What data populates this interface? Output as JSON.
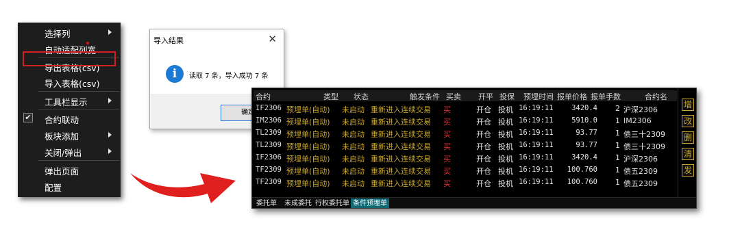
{
  "context_menu": {
    "items": [
      {
        "label": "选择列",
        "submenu": true
      },
      {
        "label": "自动适配列宽",
        "submenu": false
      },
      {
        "label": "导出表格(csv)",
        "submenu": false
      },
      {
        "label": "导入表格(csv)",
        "submenu": false,
        "highlighted": true
      },
      {
        "label": "工具栏显示",
        "submenu": true
      },
      {
        "label": "合约联动",
        "submenu": false,
        "checked": true
      },
      {
        "label": "板块添加",
        "submenu": true
      },
      {
        "label": "关闭/弹出",
        "submenu": true
      },
      {
        "label": "弹出页面",
        "submenu": false
      },
      {
        "label": "配置",
        "submenu": false
      }
    ],
    "check_mark": "✔"
  },
  "dialog": {
    "title": "导入结果",
    "close": "✕",
    "icon": "i",
    "message": "读取 7 条，导入成功 7 条",
    "ok_button": "确定"
  },
  "table": {
    "headers": {
      "contract": "合约",
      "type": "类型",
      "status": "状态",
      "trigger": "触发条件",
      "side": "买卖",
      "open": "开平",
      "hedge": "投保",
      "time": "预埋时间",
      "price": "报单价格",
      "qty": "报单手数",
      "name": "合约名"
    },
    "rows": [
      {
        "contract": "IF2306",
        "type": "预埋单(自动)",
        "status": "未启动",
        "trigger": "重新进入连续交易",
        "side": "买",
        "open": "开仓",
        "hedge": "投机",
        "time": "16:19:11",
        "price": "3420.4",
        "qty": "2",
        "name": "沪深2306"
      },
      {
        "contract": "IM2306",
        "type": "预埋单(自动)",
        "status": "未启动",
        "trigger": "重新进入连续交易",
        "side": "买",
        "open": "开仓",
        "hedge": "投机",
        "time": "16:19:11",
        "price": "5910.0",
        "qty": "1",
        "name": "IM2306"
      },
      {
        "contract": "TL2309",
        "type": "预埋单(自动)",
        "status": "未启动",
        "trigger": "重新进入连续交易",
        "side": "买",
        "open": "开仓",
        "hedge": "投机",
        "time": "16:19:11",
        "price": "93.77",
        "qty": "1",
        "name": "债三十2309"
      },
      {
        "contract": "TL2309",
        "type": "预埋单(自动)",
        "status": "未启动",
        "trigger": "重新进入连续交易",
        "side": "买",
        "open": "开仓",
        "hedge": "投机",
        "time": "16:19:11",
        "price": "93.77",
        "qty": "1",
        "name": "债三十2309"
      },
      {
        "contract": "IF2306",
        "type": "预埋单(自动)",
        "status": "未启动",
        "trigger": "重新进入连续交易",
        "side": "买",
        "open": "开仓",
        "hedge": "投机",
        "time": "16:19:11",
        "price": "3420.4",
        "qty": "1",
        "name": "沪深2306"
      },
      {
        "contract": "TF2309",
        "type": "预埋单(自动)",
        "status": "未启动",
        "trigger": "重新进入连续交易",
        "side": "买",
        "open": "开仓",
        "hedge": "投机",
        "time": "16:19:11",
        "price": "100.760",
        "qty": "1",
        "name": "债五2309"
      },
      {
        "contract": "TF2309",
        "type": "预埋单(自动)",
        "status": "未启动",
        "trigger": "重新进入连续交易",
        "side": "买",
        "open": "开仓",
        "hedge": "投机",
        "time": "16:19:11",
        "price": "100.760",
        "qty": "1",
        "name": "债五2309"
      }
    ]
  },
  "side_buttons": [
    "增",
    "改",
    "删",
    "清",
    "发"
  ],
  "tabs": [
    {
      "label": "委托单",
      "active": false
    },
    {
      "label": "未成委托",
      "active": false
    },
    {
      "label": "行权委托单",
      "active": false
    },
    {
      "label": "条件预埋单",
      "active": true
    }
  ],
  "colors": {
    "menu_bg": "#1d1d1d",
    "highlight_border": "#d32020",
    "arrow_red": "#e0201e",
    "panel_bg": "#000000",
    "gold_text": "#c9a628",
    "sell_buy_red": "#e03030",
    "active_tab": "#0f6872",
    "info_blue": "#1a7ad4"
  }
}
